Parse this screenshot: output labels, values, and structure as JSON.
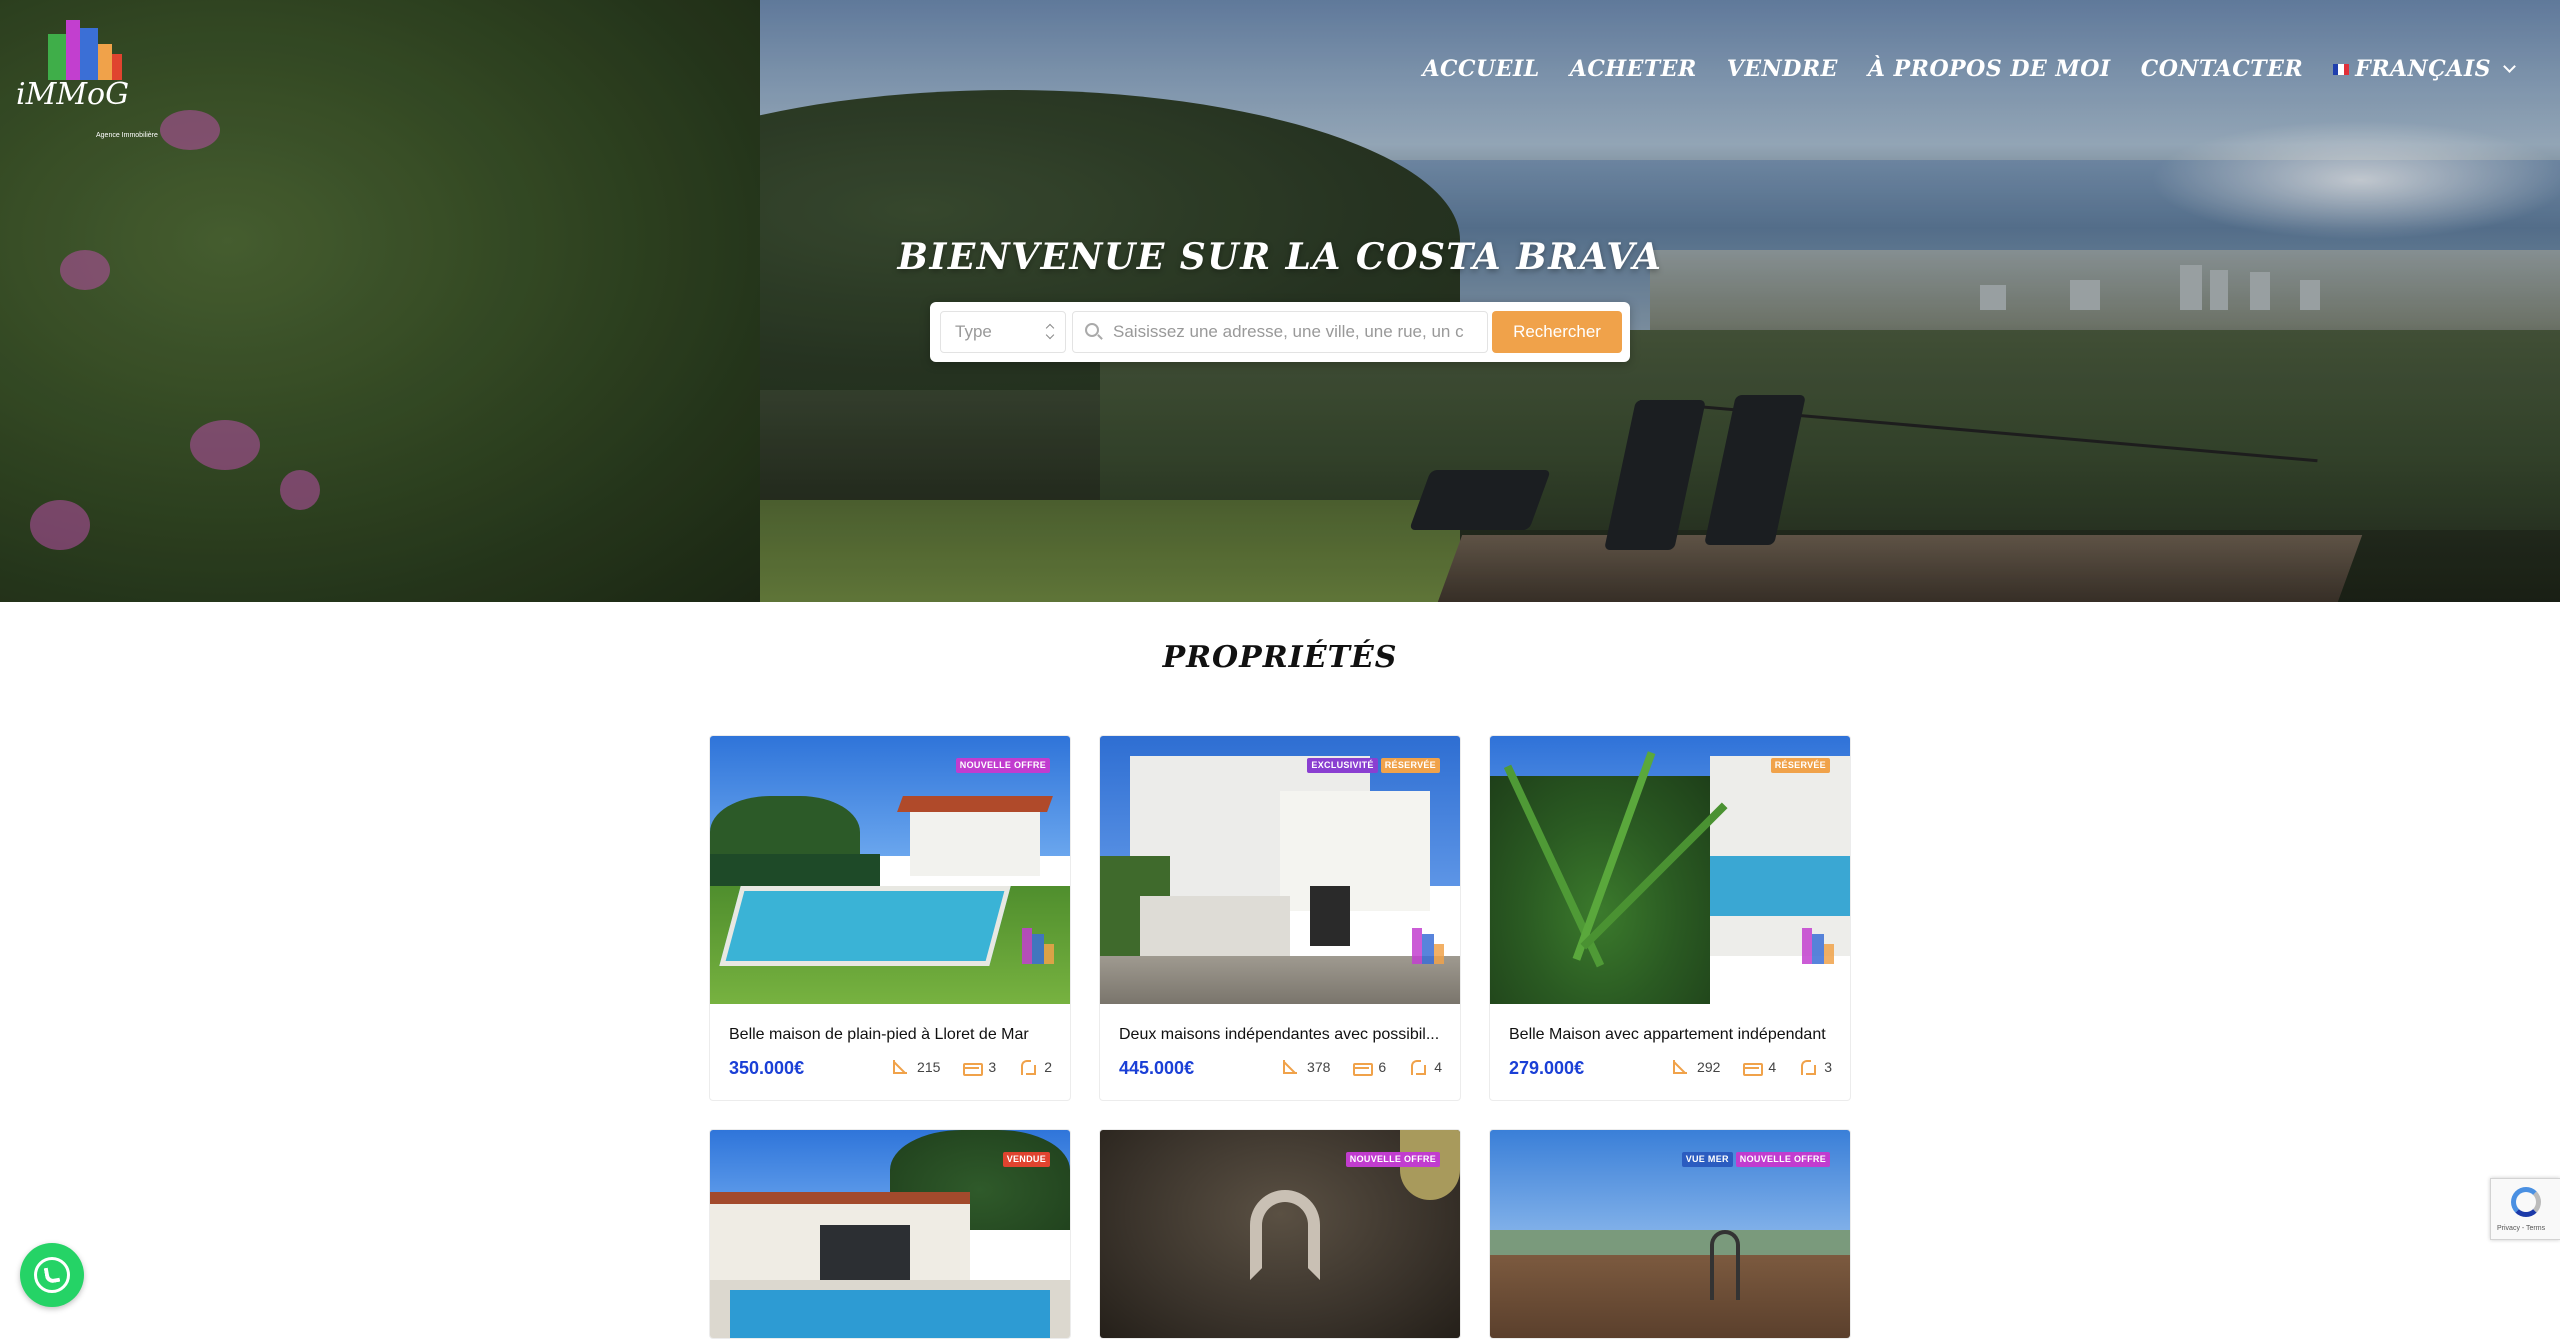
{
  "header": {
    "logo_text": "iMMoG",
    "logo_subtitle": "Agence Immobilière",
    "nav": [
      "ACCUEIL",
      "ACHETER",
      "VENDRE",
      "À PROPOS DE MOI",
      "CONTACTER"
    ],
    "language": "FRANÇAIS"
  },
  "hero": {
    "title": "BIENVENUE SUR LA COSTA BRAVA",
    "search": {
      "type_placeholder": "Type",
      "input_placeholder": "Saisissez une adresse, une ville, une rue, un c",
      "button_label": "Rechercher"
    }
  },
  "section": {
    "title": "PROPRIÉTÉS"
  },
  "properties": [
    {
      "title": "Belle maison de plain-pied à Lloret de Mar",
      "price": "350.000€",
      "area": "215",
      "bedrooms": "3",
      "bathrooms": "2",
      "badges": [
        {
          "label": "NOUVELLE OFFRE",
          "color": "#c13ccf"
        }
      ]
    },
    {
      "title": "Deux maisons indépendantes avec possibil...",
      "price": "445.000€",
      "area": "378",
      "bedrooms": "6",
      "bathrooms": "4",
      "badges": [
        {
          "label": "EXCLUSIVITÉ",
          "color": "#8a3fd1"
        },
        {
          "label": "RÉSERVÉE",
          "color": "#f0a24a"
        }
      ]
    },
    {
      "title": "Belle Maison avec appartement indépendant",
      "price": "279.000€",
      "area": "292",
      "bedrooms": "4",
      "bathrooms": "3",
      "badges": [
        {
          "label": "RÉSERVÉE",
          "color": "#f0a24a"
        }
      ]
    },
    {
      "badges": [
        {
          "label": "VENDUE",
          "color": "#e0432f"
        }
      ]
    },
    {
      "badges": [
        {
          "label": "NOUVELLE OFFRE",
          "color": "#c13ccf"
        }
      ]
    },
    {
      "badges": [
        {
          "label": "VUE MER",
          "color": "#2b5cc0"
        },
        {
          "label": "NOUVELLE OFFRE",
          "color": "#c13ccf"
        }
      ]
    }
  ],
  "widgets": {
    "recaptcha_text": "Privacy - Terms"
  },
  "colors": {
    "accent": "#f0a24a",
    "price": "#1a3fd6"
  }
}
